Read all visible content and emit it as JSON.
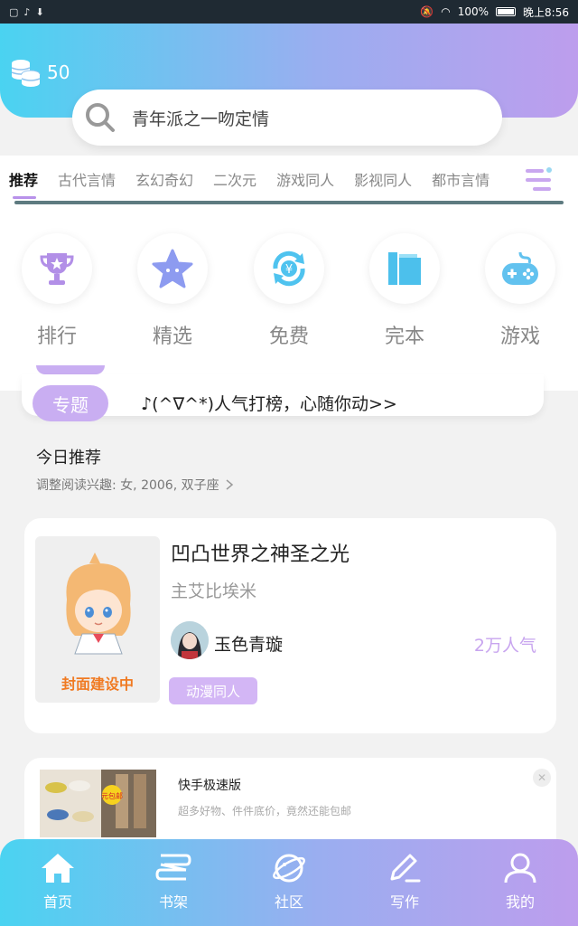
{
  "status_bar": {
    "battery": "100%",
    "time": "晚上8:56"
  },
  "header": {
    "coins": "50"
  },
  "search": {
    "placeholder": "青年派之一吻定情"
  },
  "categories": [
    {
      "label": "推荐"
    },
    {
      "label": "古代言情"
    },
    {
      "label": "玄幻奇幻"
    },
    {
      "label": "二次元"
    },
    {
      "label": "游戏同人"
    },
    {
      "label": "影视同人"
    },
    {
      "label": "都市言情"
    }
  ],
  "quick_links": [
    {
      "label": "排行",
      "icon": "trophy-icon",
      "color": "#b28fe7"
    },
    {
      "label": "精选",
      "icon": "star-icon",
      "color": "#8d9bf0"
    },
    {
      "label": "免费",
      "icon": "yen-refresh-icon",
      "color": "#4fc3ef"
    },
    {
      "label": "完本",
      "icon": "book-icon",
      "color": "#4cc0ec"
    },
    {
      "label": "游戏",
      "icon": "gamepad-icon",
      "color": "#62c2ef"
    }
  ],
  "topic": {
    "tab_label": "专题",
    "text": "♪(^∇^*)人气打榜，心随你动>>"
  },
  "today": {
    "title": "今日推荐",
    "interest": "调整阅读兴趣: 女, 2006, 双子座"
  },
  "book": {
    "title": "凹凸世界之神圣之光",
    "lead": "主艾比埃米",
    "author": "玉色青璇",
    "popularity": "2万人气",
    "genre": "动漫同人",
    "cover_text": "封面建设中"
  },
  "ad": {
    "title": "快手极速版",
    "description": "超多好物、件件底价，竟然还能包邮",
    "badge": "元包邮"
  },
  "bottom_nav": [
    {
      "label": "首页",
      "icon": "home-icon"
    },
    {
      "label": "书架",
      "icon": "bookshelf-icon"
    },
    {
      "label": "社区",
      "icon": "planet-icon"
    },
    {
      "label": "写作",
      "icon": "pen-icon"
    },
    {
      "label": "我的",
      "icon": "profile-icon"
    }
  ],
  "colors": {
    "accent": "#b891ea",
    "gradient_start": "#4ad3f1",
    "gradient_end": "#bd9ded"
  }
}
